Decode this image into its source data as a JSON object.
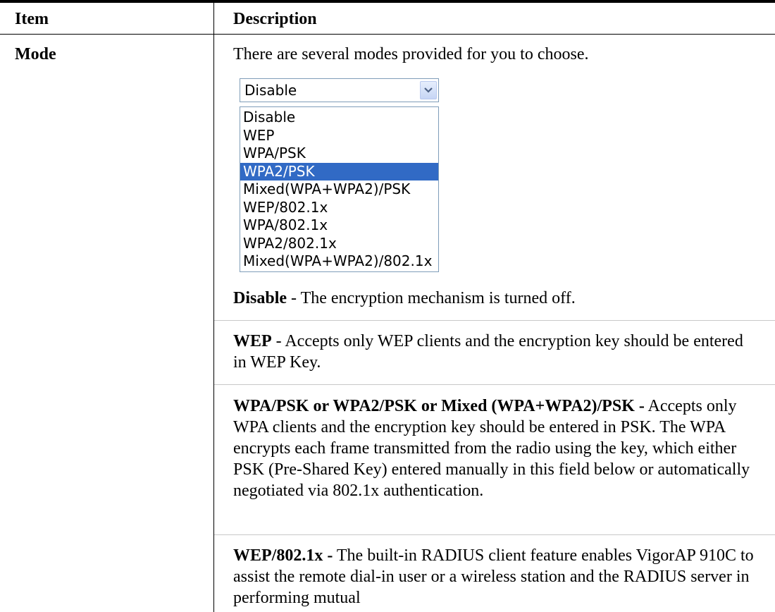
{
  "header": {
    "item": "Item",
    "description": "Description"
  },
  "row": {
    "label": "Mode",
    "intro": "There are several modes provided for you to choose.",
    "select": {
      "value": "Disable",
      "options": [
        "Disable",
        "WEP",
        "WPA/PSK",
        "WPA2/PSK",
        "Mixed(WPA+WPA2)/PSK",
        "WEP/802.1x",
        "WPA/802.1x",
        "WPA2/802.1x",
        "Mixed(WPA+WPA2)/802.1x"
      ],
      "highlighted_option": "WPA2/PSK"
    },
    "paragraphs": [
      {
        "term": "Disable",
        "text": " - The encryption mechanism is turned off."
      },
      {
        "term": "WEP",
        "text": " - Accepts only WEP clients and the encryption key should be entered in WEP Key."
      },
      {
        "term": "WPA/PSK or WPA2/PSK or Mixed (WPA+WPA2)/PSK -",
        "text": " Accepts only WPA clients and the encryption key should be entered in PSK. The WPA encrypts each frame transmitted from the radio using the key, which either PSK (Pre-Shared Key) entered manually in this field below or automatically negotiated via 802.1x authentication."
      },
      {
        "term": "WEP/802.1x -",
        "text": " The built-in RADIUS client feature enables VigorAP 910C to assist the remote dial-in user or a wireless station and the RADIUS server in performing mutual"
      }
    ]
  },
  "colors": {
    "highlight": "#316ac5",
    "select_border": "#7f9db9"
  }
}
